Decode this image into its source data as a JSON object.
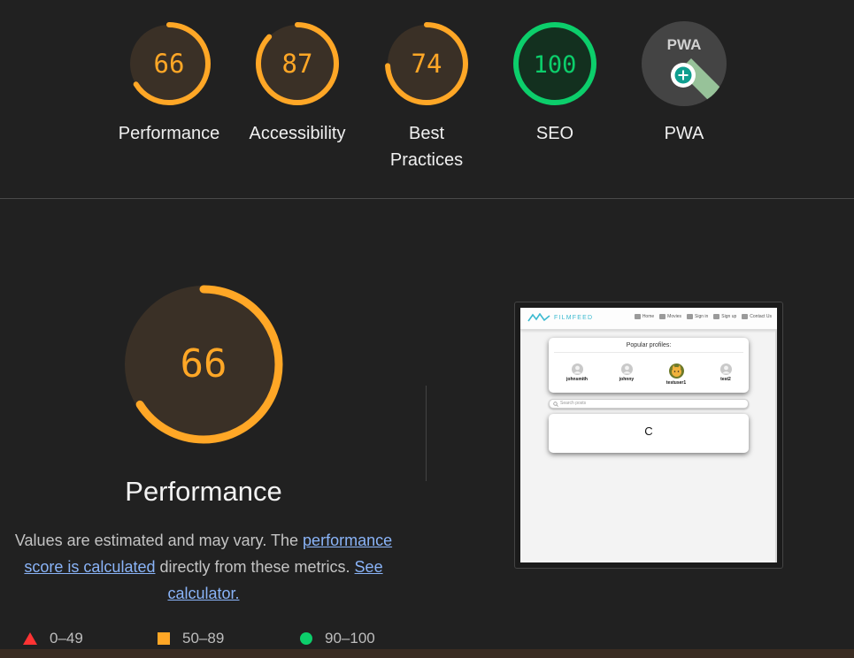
{
  "colors": {
    "background": "#212121",
    "average": "#ffa726",
    "average_track": "#3a3026",
    "pass": "#0cce6b",
    "pass_track": "#13301f",
    "fail": "#ff3333",
    "link": "#8ab4f8",
    "pwa_bg": "#444444"
  },
  "categories": [
    {
      "id": "performance",
      "score": 66,
      "label": "Performance",
      "rating": "average"
    },
    {
      "id": "accessibility",
      "score": 87,
      "label": "Accessibility",
      "rating": "average"
    },
    {
      "id": "best-practices",
      "score": 74,
      "label_line1": "Best",
      "label_line2": "Practices",
      "rating": "average"
    },
    {
      "id": "seo",
      "score": 100,
      "label": "SEO",
      "rating": "pass"
    },
    {
      "id": "pwa",
      "badge_text": "PWA",
      "label": "PWA",
      "icon": "pwa-badge-icon"
    }
  ],
  "performance": {
    "score": 66,
    "title": "Performance",
    "desc_part1": "Values are estimated and may vary. The ",
    "desc_link1": "performance score is calculated",
    "desc_part2": " directly from these metrics. ",
    "desc_link2": "See calculator."
  },
  "legend": [
    {
      "range": "0–49",
      "icon": "triangle-icon",
      "color": "#ff3333"
    },
    {
      "range": "50–89",
      "icon": "square-icon",
      "color": "#ffa726"
    },
    {
      "range": "90–100",
      "icon": "circle-icon",
      "color": "#0cce6b"
    }
  ],
  "screenshot": {
    "brand": "FILMFEED",
    "nav": [
      "Home",
      "Movies",
      "Sign in",
      "Sign up",
      "Contact Us"
    ],
    "popular_title": "Popular profiles:",
    "profiles": [
      "johnsmith",
      "johnny",
      "testuser1",
      "test2"
    ],
    "search_placeholder": "Search posts",
    "loading_glyph": "C"
  }
}
